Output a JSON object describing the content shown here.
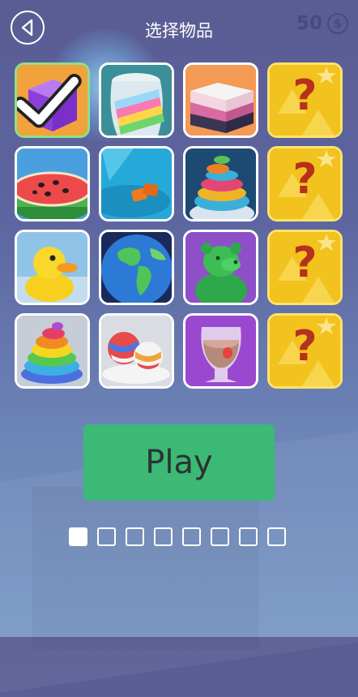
{
  "header": {
    "title": "选择物品",
    "coins": "50",
    "coin_symbol": "$"
  },
  "grid": {
    "items": [
      {
        "id": "purple-cube",
        "selected": true
      },
      {
        "id": "rainbow-slime"
      },
      {
        "id": "striped-block"
      },
      {
        "id": "locked-1",
        "locked_label": "?"
      },
      {
        "id": "watermelon"
      },
      {
        "id": "orange-shapes"
      },
      {
        "id": "spiral-tower"
      },
      {
        "id": "locked-2",
        "locked_label": "?"
      },
      {
        "id": "rubber-duck"
      },
      {
        "id": "earth-globe"
      },
      {
        "id": "green-bear"
      },
      {
        "id": "locked-3",
        "locked_label": "?"
      },
      {
        "id": "rainbow-swirl"
      },
      {
        "id": "striped-balls"
      },
      {
        "id": "smoothie-glass"
      },
      {
        "id": "locked-4",
        "locked_label": "?"
      }
    ]
  },
  "play_button": {
    "label": "Play"
  },
  "pager": {
    "total": 8,
    "active": 1
  },
  "colors": {
    "play": "#3bb975",
    "selected_border": "#8fe08a",
    "locked_gold": "#f2c21e"
  }
}
